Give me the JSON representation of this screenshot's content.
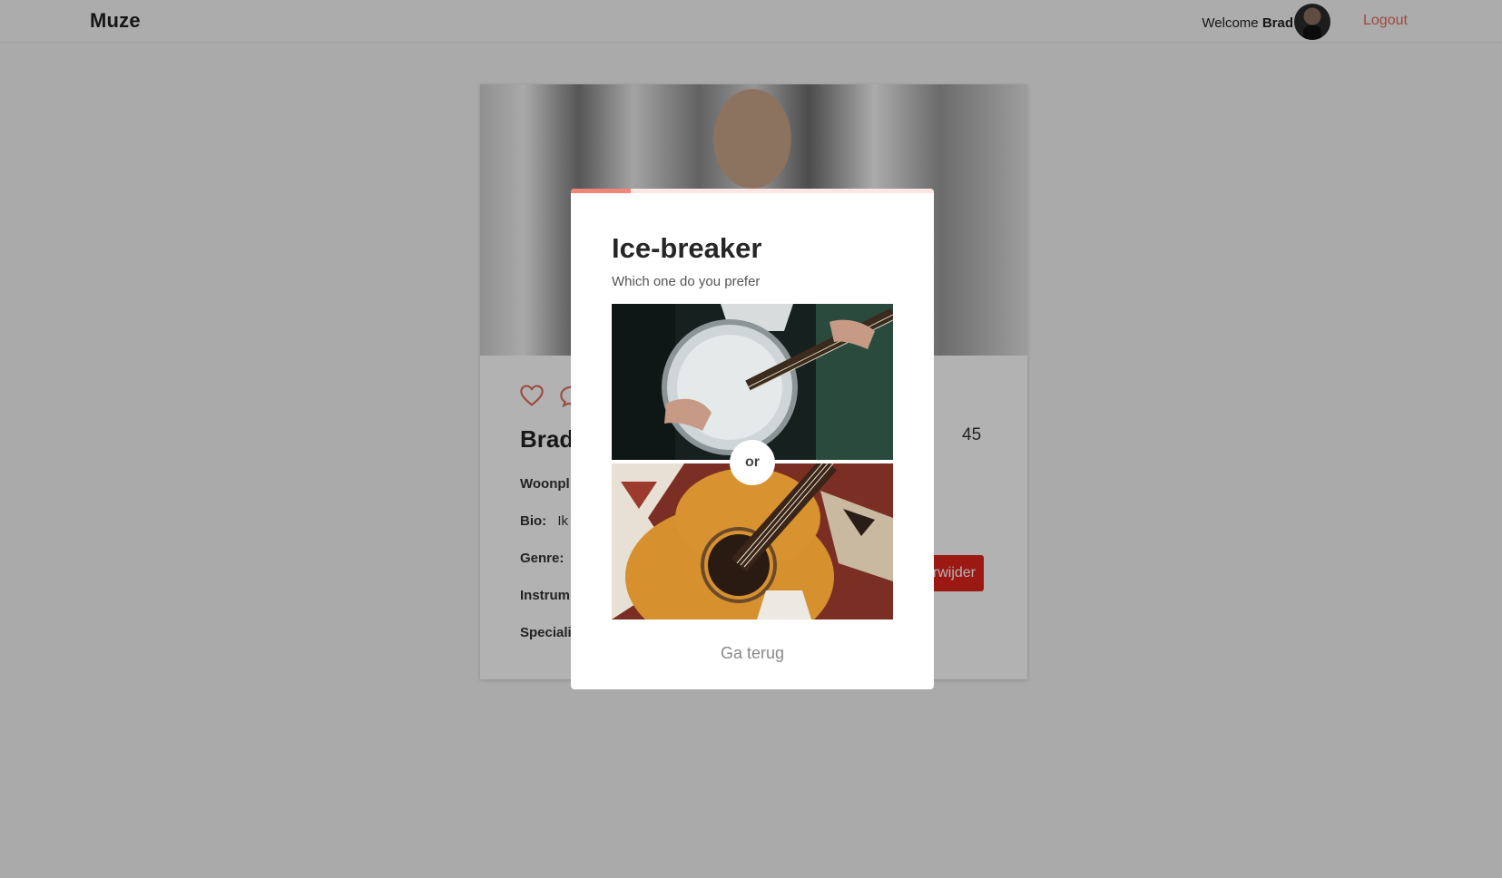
{
  "header": {
    "brand": "Muze",
    "welcome_prefix": "Welcome",
    "user_name": "Brad",
    "logout_label": "Logout"
  },
  "profile": {
    "name": "Brad",
    "age": "45",
    "fields": {
      "residence_label": "Woonpl",
      "bio_label": "Bio:",
      "bio_value": "Ik",
      "genre_label": "Genre:",
      "instrument_label": "Instrum",
      "special_label": "Speciali"
    },
    "delete_label": "rwijder"
  },
  "modal": {
    "title": "Ice-breaker",
    "subtitle": "Which one do you prefer",
    "progress": 0.165,
    "or_label": "or",
    "back_label": "Ga terug"
  },
  "colors": {
    "accent": "#f08476",
    "logout": "#e06a5a",
    "danger": "#e0251c"
  }
}
